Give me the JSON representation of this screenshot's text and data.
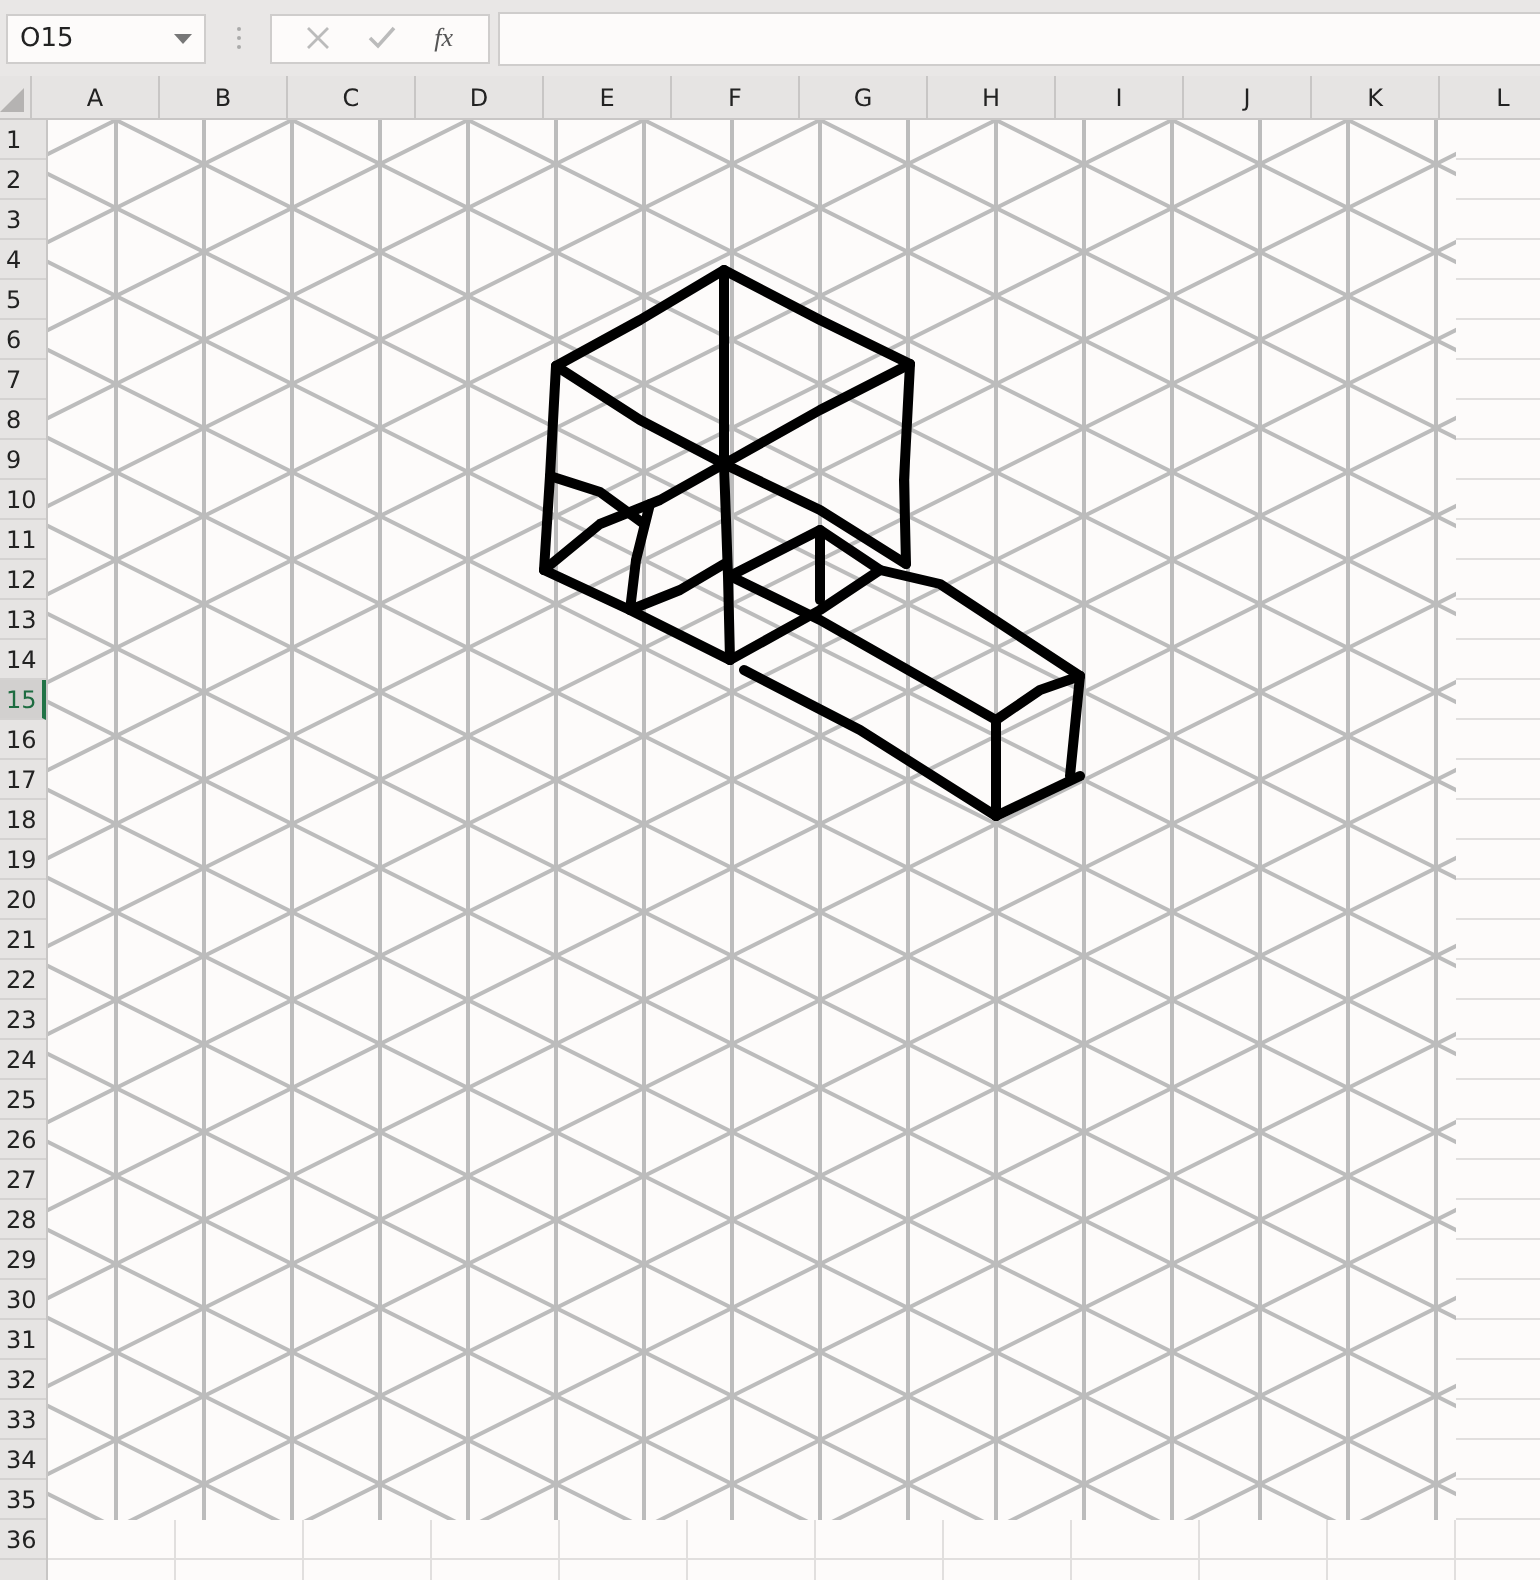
{
  "name_box": {
    "value": "O15"
  },
  "formula_bar": {
    "function_label": "fx"
  },
  "columns": [
    "A",
    "B",
    "C",
    "D",
    "E",
    "F",
    "G",
    "H",
    "I",
    "J",
    "K",
    "L"
  ],
  "rows": [
    {
      "label": "1",
      "selected": false
    },
    {
      "label": "2",
      "selected": false
    },
    {
      "label": "3",
      "selected": false
    },
    {
      "label": "4",
      "selected": false
    },
    {
      "label": "5",
      "selected": false
    },
    {
      "label": "6",
      "selected": false
    },
    {
      "label": "7",
      "selected": false
    },
    {
      "label": "8",
      "selected": false
    },
    {
      "label": "9",
      "selected": false
    },
    {
      "label": "10",
      "selected": false
    },
    {
      "label": "11",
      "selected": false
    },
    {
      "label": "12",
      "selected": false
    },
    {
      "label": "13",
      "selected": false
    },
    {
      "label": "14",
      "selected": false
    },
    {
      "label": "15",
      "selected": true
    },
    {
      "label": "16",
      "selected": false
    },
    {
      "label": "17",
      "selected": false
    },
    {
      "label": "18",
      "selected": false
    },
    {
      "label": "19",
      "selected": false
    },
    {
      "label": "20",
      "selected": false
    },
    {
      "label": "21",
      "selected": false
    },
    {
      "label": "22",
      "selected": false
    },
    {
      "label": "23",
      "selected": false
    },
    {
      "label": "24",
      "selected": false
    },
    {
      "label": "25",
      "selected": false
    },
    {
      "label": "26",
      "selected": false
    },
    {
      "label": "27",
      "selected": false
    },
    {
      "label": "28",
      "selected": false
    },
    {
      "label": "29",
      "selected": false
    },
    {
      "label": "30",
      "selected": false
    },
    {
      "label": "31",
      "selected": false
    },
    {
      "label": "32",
      "selected": false
    },
    {
      "label": "33",
      "selected": false
    },
    {
      "label": "34",
      "selected": false
    },
    {
      "label": "35",
      "selected": false
    },
    {
      "label": "36",
      "selected": false
    }
  ]
}
